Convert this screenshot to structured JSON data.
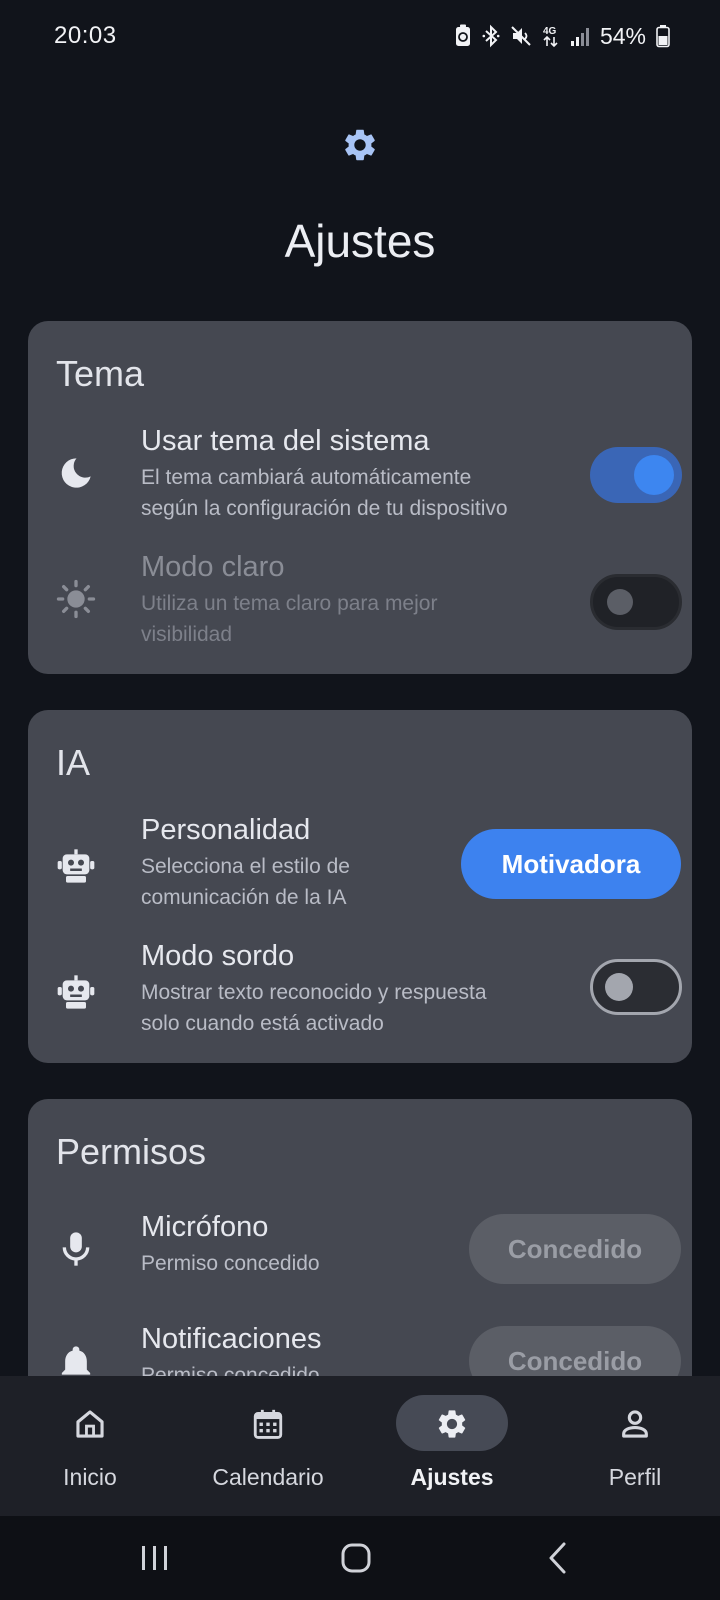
{
  "status_bar": {
    "time": "20:03",
    "battery": "54%",
    "network": "4G",
    "icons": [
      "battery-saver-icon",
      "bluetooth-icon",
      "mute-icon",
      "network-4g-icon",
      "signal-icon",
      "battery-icon"
    ]
  },
  "header": {
    "icon": "gear-icon",
    "title": "Ajustes"
  },
  "sections": {
    "tema": {
      "title": "Tema",
      "system_theme": {
        "title": "Usar tema del sistema",
        "desc_line1": "El tema cambiará automáticamente",
        "desc_line2": "según la configuración de tu dispositivo",
        "icon": "moon-icon",
        "enabled": true
      },
      "light_mode": {
        "title": "Modo claro",
        "desc_line1": "Utiliza un tema claro para mejor",
        "desc_line2": "visibilidad",
        "icon": "sun-icon",
        "enabled": false,
        "disabled": true
      }
    },
    "ia": {
      "title": "IA",
      "personality": {
        "title": "Personalidad",
        "desc_line1": "Selecciona el estilo de",
        "desc_line2": "comunicación de la IA",
        "icon": "robot-icon",
        "value": "Motivadora"
      },
      "deaf_mode": {
        "title": "Modo sordo",
        "desc_line1": "Mostrar texto reconocido y respuesta",
        "desc_line2": "solo cuando está activado",
        "icon": "robot-icon",
        "enabled": false
      }
    },
    "permisos": {
      "title": "Permisos",
      "microphone": {
        "title": "Micrófono",
        "desc": "Permiso concedido",
        "icon": "microphone-icon",
        "button": "Concedido"
      },
      "notifications": {
        "title": "Notificaciones",
        "desc": "Permiso concedido",
        "icon": "bell-icon",
        "button": "Concedido"
      }
    }
  },
  "bottom_nav": {
    "items": [
      {
        "label": "Inicio",
        "icon": "home-icon",
        "active": false
      },
      {
        "label": "Calendario",
        "icon": "calendar-icon",
        "active": false
      },
      {
        "label": "Ajustes",
        "icon": "gear-icon",
        "active": true
      },
      {
        "label": "Perfil",
        "icon": "person-icon",
        "active": false
      }
    ]
  },
  "system_nav": {
    "icons": [
      "recents-icon",
      "home-circle-icon",
      "back-icon"
    ]
  },
  "colors": {
    "background": "#11141b",
    "card": "#454851",
    "accent": "#3d82ef",
    "toggle_on_track": "#3a66b6",
    "header_gear": "#a8c4f5"
  }
}
